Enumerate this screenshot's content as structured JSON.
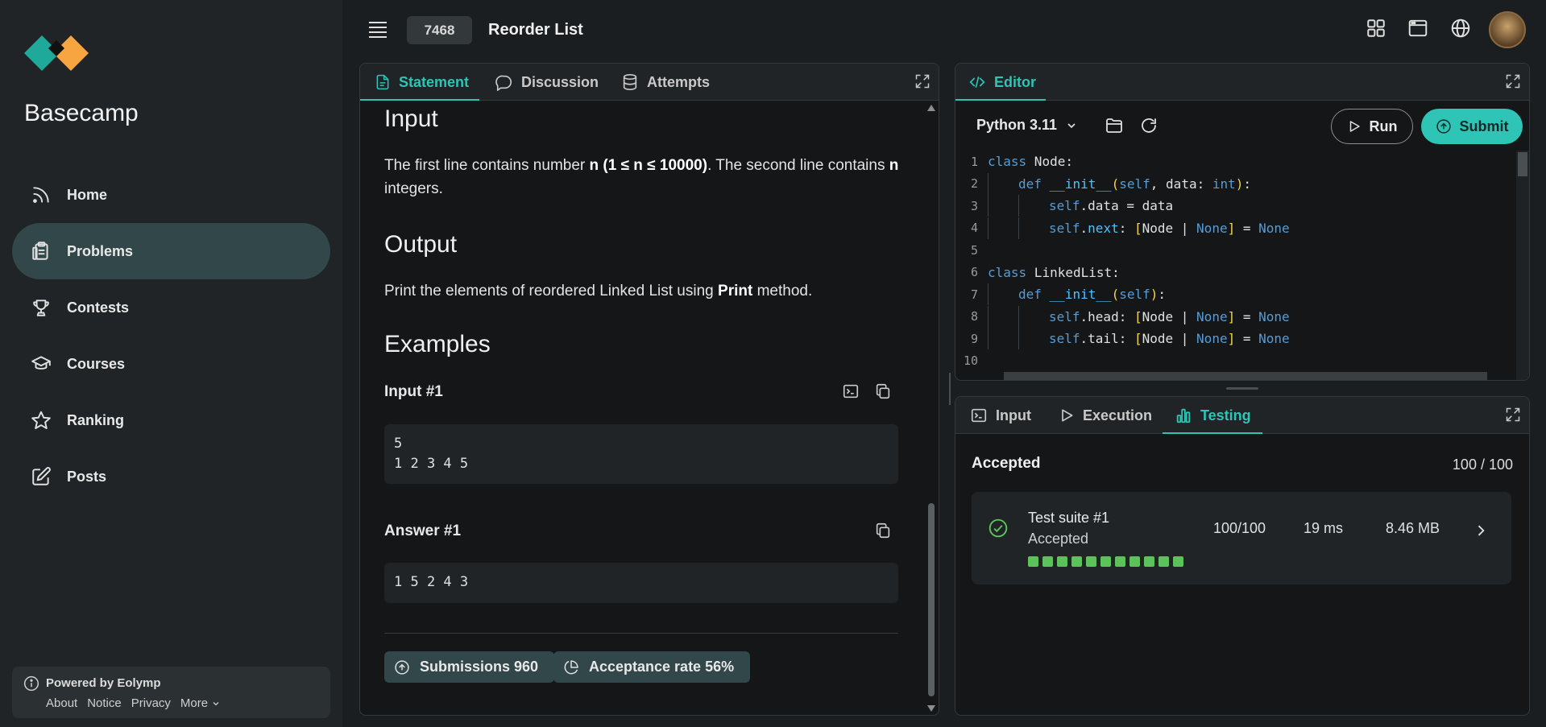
{
  "sidebar": {
    "brand": "Basecamp",
    "items": [
      {
        "label": "Home",
        "icon": "rss-icon"
      },
      {
        "label": "Problems",
        "icon": "clipboard-icon"
      },
      {
        "label": "Contests",
        "icon": "trophy-icon"
      },
      {
        "label": "Courses",
        "icon": "graduation-cap-icon"
      },
      {
        "label": "Ranking",
        "icon": "star-icon"
      },
      {
        "label": "Posts",
        "icon": "edit-icon"
      }
    ],
    "footer": {
      "powered": "Powered by Eolymp",
      "links": [
        "About",
        "Notice",
        "Privacy",
        "More"
      ]
    }
  },
  "header": {
    "problem_id": "7468",
    "problem_title": "Reorder List"
  },
  "statement_panel": {
    "tabs": [
      "Statement",
      "Discussion",
      "Attempts"
    ],
    "input_heading": "Input",
    "input_text_1": "The first line contains number ",
    "input_n": "n",
    "input_range": " (1 ≤ ",
    "input_n2": "n",
    "input_range2": " ≤ 10000)",
    "input_text_2": ". The second line contains ",
    "input_n3": "n",
    "input_text_3": " integers.",
    "output_heading": "Output",
    "output_text_1": "Print the elements of reordered Linked List using ",
    "output_print": "Print",
    "output_text_2": " method.",
    "examples_heading": "Examples",
    "input_example_label": "Input #1",
    "input_example_value": "5\n1 2 3 4 5",
    "answer_example_label": "Answer #1",
    "answer_example_value": "1 5 2 4 3",
    "submissions": "Submissions 960",
    "acceptance": "Acceptance rate 56%"
  },
  "editor": {
    "tab": "Editor",
    "language": "Python 3.11",
    "run_label": "Run",
    "submit_label": "Submit",
    "code_lines": [
      "class Node:",
      "    def __init__(self, data: int):",
      "        self.data = data",
      "        self.next: [Node | None] = None",
      "",
      "class LinkedList:",
      "    def __init__(self):",
      "        self.head: [Node | None] = None",
      "        self.tail: [Node | None] = None",
      ""
    ]
  },
  "testing_panel": {
    "tabs": [
      "Input",
      "Execution",
      "Testing"
    ],
    "status": "Accepted",
    "score": "100 / 100",
    "suite": {
      "name": "Test suite #1",
      "status": "Accepted",
      "points": "100/100",
      "time": "19 ms",
      "memory": "8.46 MB",
      "tests_passed": 11
    }
  },
  "colors": {
    "accent": "#2ec4b6",
    "active_nav": "#32474a",
    "pass": "#5cc25c"
  }
}
